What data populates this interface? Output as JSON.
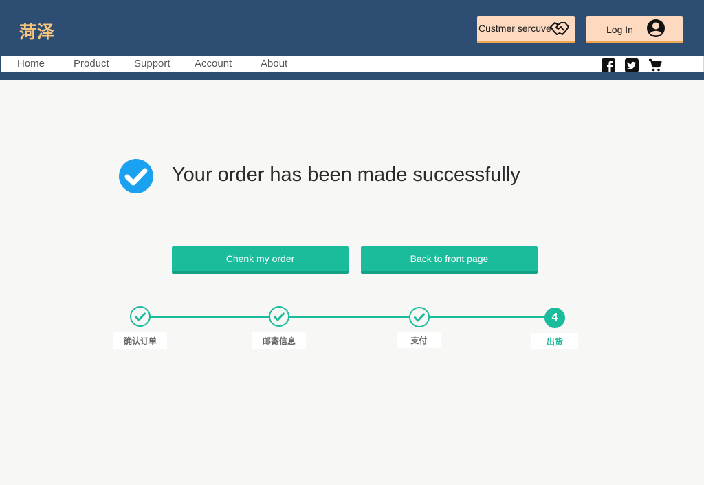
{
  "header": {
    "logo": "菏泽",
    "service_button": "Custmer sercuve",
    "login_button": "Log In"
  },
  "nav": {
    "items": [
      "Home",
      "Product",
      "Support",
      "Account",
      "About"
    ],
    "icons": [
      "facebook-icon",
      "twitter-icon",
      "cart-icon"
    ]
  },
  "main": {
    "message": "Your order has been made successfully",
    "check_order_button": "Chenk my order",
    "back_button": "Back to front page"
  },
  "steps": {
    "items": [
      {
        "label": "确认订单",
        "state": "done"
      },
      {
        "label": "邮寄信息",
        "state": "done"
      },
      {
        "label": "支付",
        "state": "done"
      },
      {
        "label": "出货",
        "state": "current",
        "number": "4"
      }
    ]
  },
  "colors": {
    "header_bg": "#2e4d73",
    "logo": "#f5c47f",
    "header_button_bg": "#fdd9bf",
    "header_button_border": "#f0a552",
    "accent": "#1abc9c",
    "success_icon": "#1aa1f0"
  }
}
